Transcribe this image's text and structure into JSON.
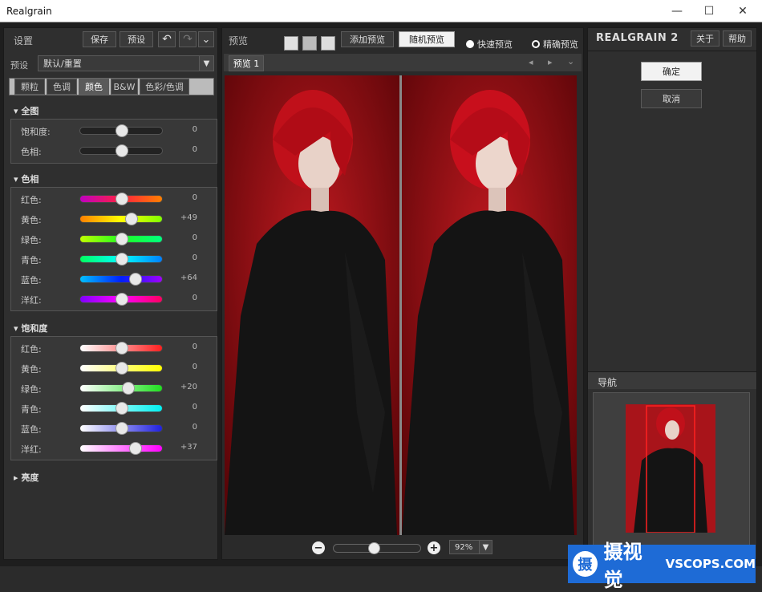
{
  "window": {
    "title": "Realgrain",
    "minimize": "—",
    "maximize": "☐",
    "close": "✕"
  },
  "left": {
    "settings_label": "设置",
    "save": "保存",
    "presets": "预设",
    "undo": "↶",
    "redo": "↷",
    "more": "⌄",
    "preset_label": "预设",
    "preset_value": "默认/重置",
    "tabs": [
      "颗粒",
      "色调",
      "颜色",
      "B&W",
      "色彩/色调"
    ],
    "active_tab": 2,
    "global": {
      "title": "全图",
      "rows": [
        {
          "label": "饱和度:",
          "value": "0",
          "pos": 0.5,
          "grad": "dark"
        },
        {
          "label": "色相:",
          "value": "0",
          "pos": 0.5,
          "grad": "dark"
        }
      ]
    },
    "hue": {
      "title": "色相",
      "rows": [
        {
          "label": "红色:",
          "value": "0",
          "pos": 0.5,
          "grad": "linear-gradient(90deg,#c000c0,#ff2040,#ff8000)"
        },
        {
          "label": "黄色:",
          "value": "+49",
          "pos": 0.62,
          "grad": "linear-gradient(90deg,#ff8000,#ffff00,#80ff00)"
        },
        {
          "label": "绿色:",
          "value": "0",
          "pos": 0.5,
          "grad": "linear-gradient(90deg,#c0ff00,#20ff20,#00ff80)"
        },
        {
          "label": "青色:",
          "value": "0",
          "pos": 0.5,
          "grad": "linear-gradient(90deg,#00ff60,#00ffff,#0080ff)"
        },
        {
          "label": "蓝色:",
          "value": "+64",
          "pos": 0.66,
          "grad": "linear-gradient(90deg,#00c0ff,#0020ff,#a000ff)"
        },
        {
          "label": "洋红:",
          "value": "0",
          "pos": 0.5,
          "grad": "linear-gradient(90deg,#8000ff,#ff00ff,#ff0060)"
        }
      ]
    },
    "sat": {
      "title": "饱和度",
      "rows": [
        {
          "label": "红色:",
          "value": "0",
          "pos": 0.5,
          "grad": "linear-gradient(90deg,#ffffff,#ff2020)"
        },
        {
          "label": "黄色:",
          "value": "0",
          "pos": 0.5,
          "grad": "linear-gradient(90deg,#ffffff,#ffff00)"
        },
        {
          "label": "绿色:",
          "value": "+20",
          "pos": 0.58,
          "grad": "linear-gradient(90deg,#ffffff,#20e020)"
        },
        {
          "label": "青色:",
          "value": "0",
          "pos": 0.5,
          "grad": "linear-gradient(90deg,#ffffff,#00f0f0)"
        },
        {
          "label": "蓝色:",
          "value": "0",
          "pos": 0.5,
          "grad": "linear-gradient(90deg,#ffffff,#2020e0)"
        },
        {
          "label": "洋红:",
          "value": "+37",
          "pos": 0.66,
          "grad": "linear-gradient(90deg,#ffffff,#ff00ff)"
        }
      ]
    },
    "brightness": "亮度"
  },
  "center": {
    "preview_label": "预览",
    "add_preview": "添加预览",
    "random_preview": "随机预览",
    "fast_preview": "快速预览",
    "precise_preview": "精确预览",
    "tab": "预览 1",
    "zoom": "92%",
    "zoom_pos": 0.45
  },
  "right": {
    "brand": "REALGRAIN",
    "brand_num": "2",
    "about": "关于",
    "help": "帮助",
    "ok": "确定",
    "cancel": "取消",
    "nav_label": "导航"
  },
  "watermark": {
    "text": "摄视觉",
    "url": "VSCOPS.COM"
  }
}
